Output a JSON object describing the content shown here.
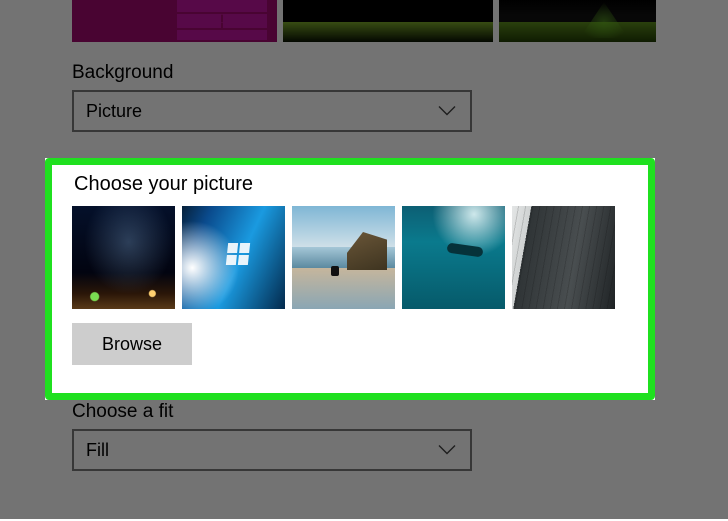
{
  "background": {
    "label": "Background",
    "selected": "Picture"
  },
  "choose_picture": {
    "label": "Choose your picture",
    "thumbs": [
      {
        "name": "milky-way-tent"
      },
      {
        "name": "windows-10-light"
      },
      {
        "name": "beach-rock"
      },
      {
        "name": "underwater"
      },
      {
        "name": "cliff-bw"
      }
    ],
    "browse_label": "Browse"
  },
  "fit": {
    "label": "Choose a fit",
    "selected": "Fill"
  }
}
